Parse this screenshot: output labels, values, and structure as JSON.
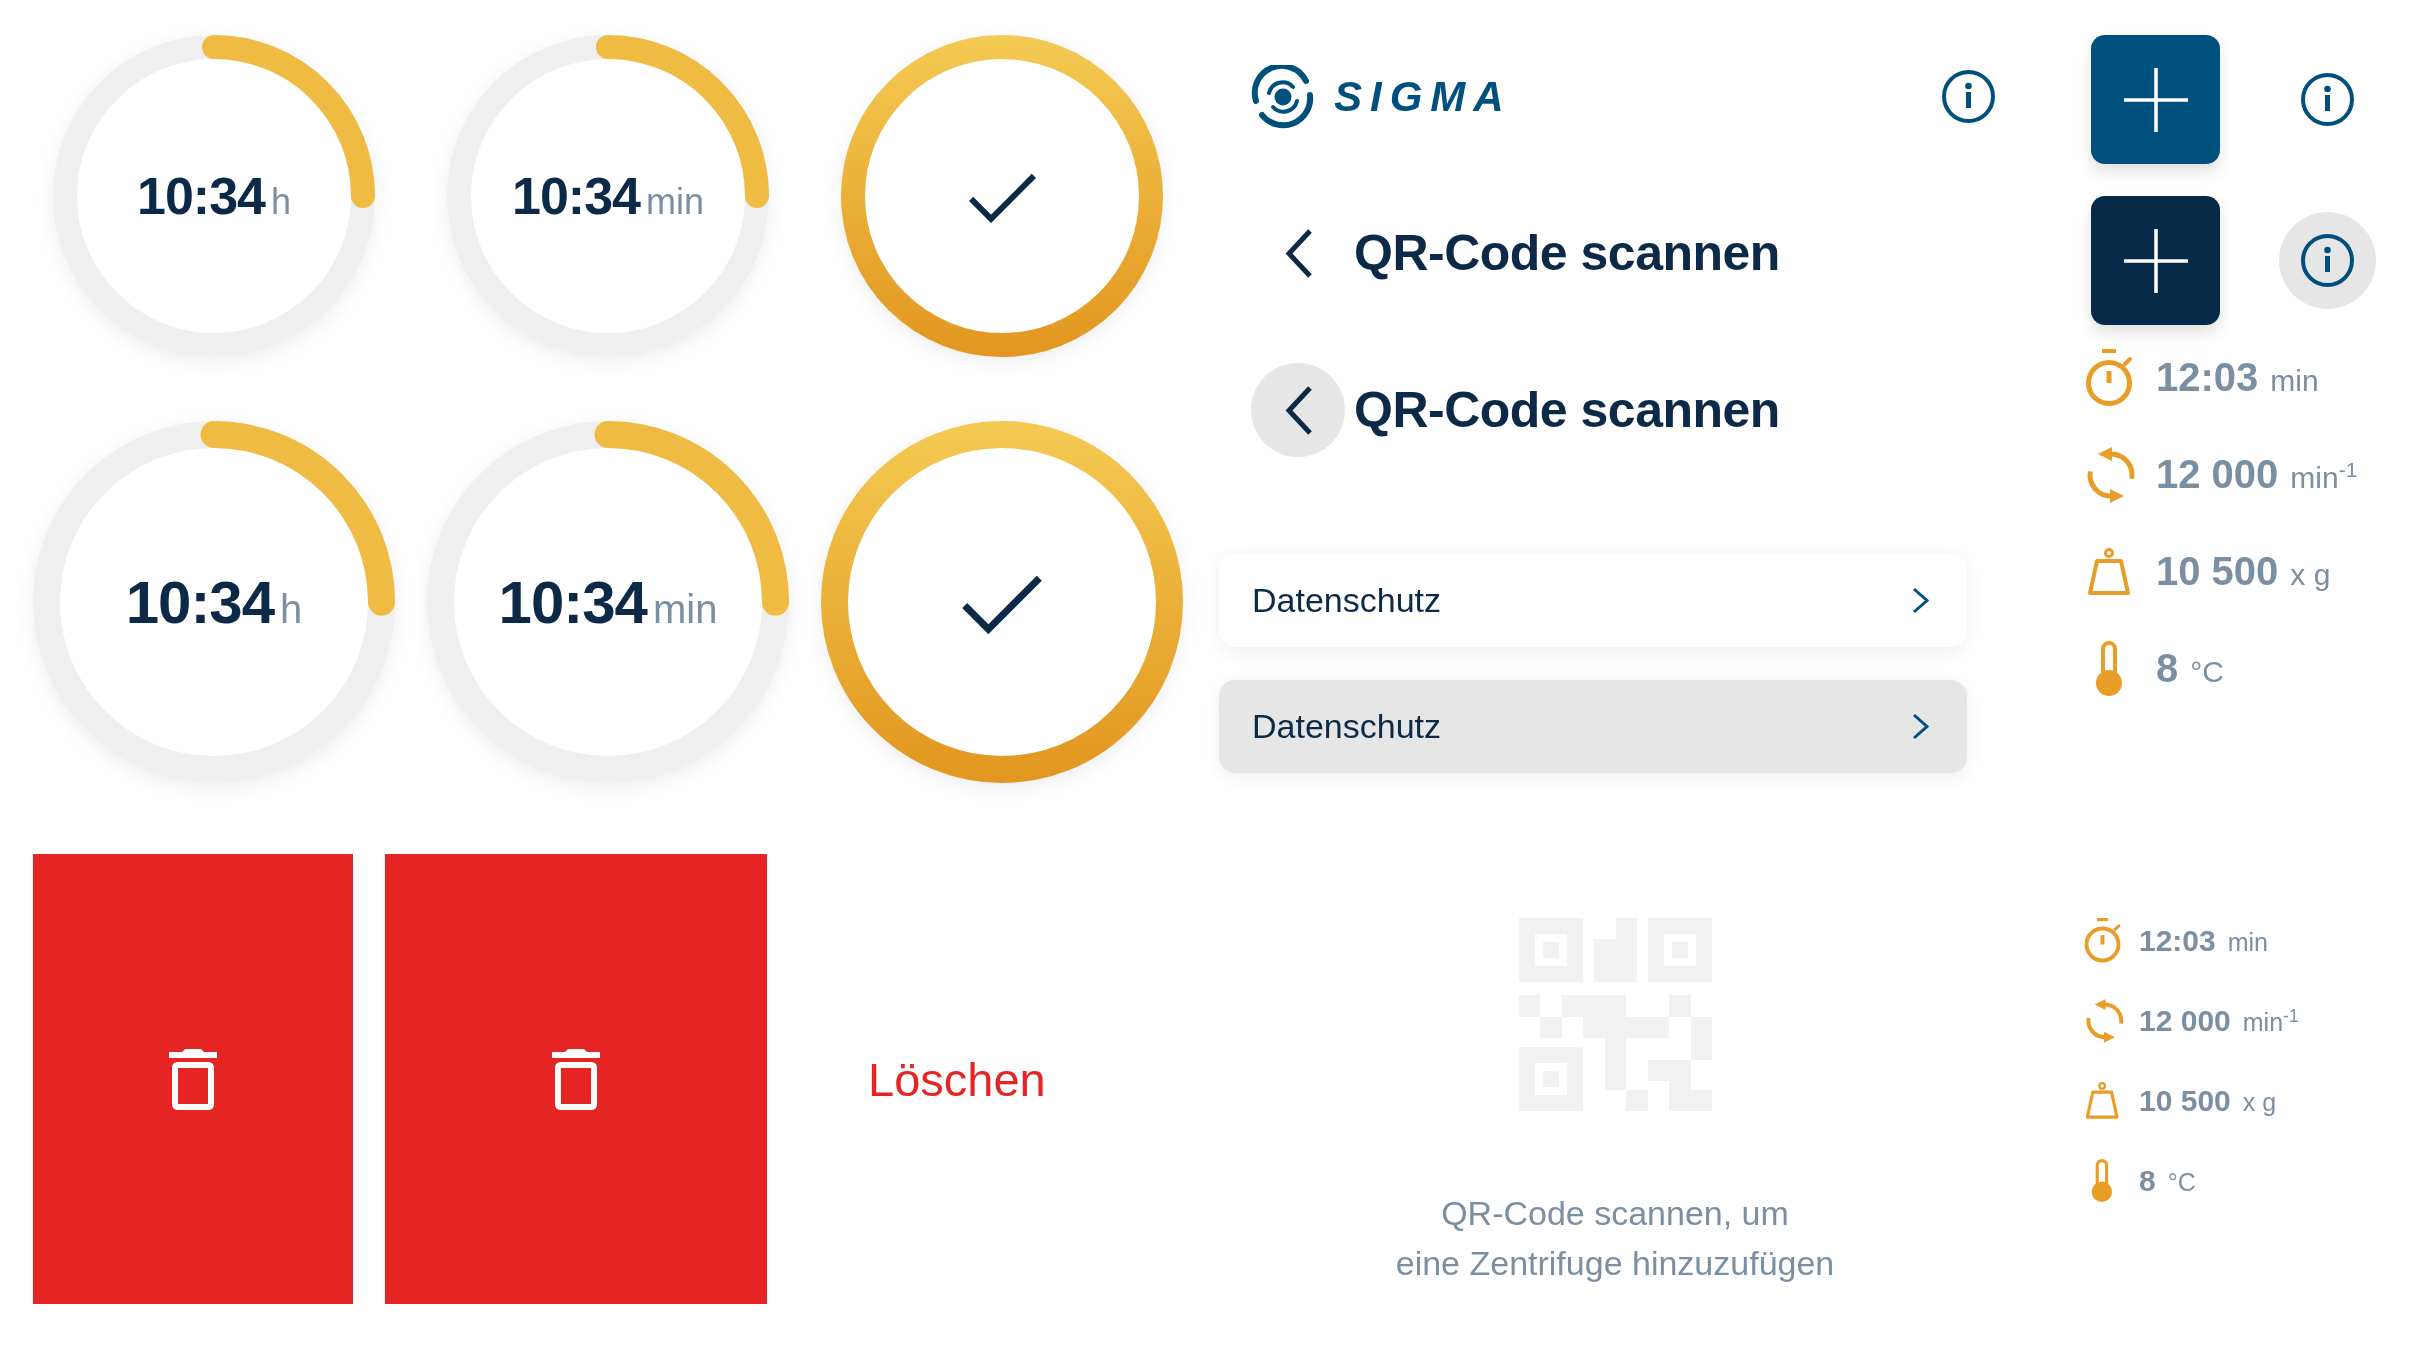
{
  "ring_rows": [
    {
      "rings": [
        {
          "kind": "progress",
          "value": "10:34",
          "unit": "h",
          "level": 0.25
        },
        {
          "kind": "progress",
          "value": "10:34",
          "unit": "min",
          "level": 0.25
        },
        {
          "kind": "done",
          "level": 1
        }
      ]
    },
    {
      "rings": [
        {
          "kind": "progress",
          "value": "10:34",
          "unit": "h",
          "level": 0.25
        },
        {
          "kind": "progress",
          "value": "10:34",
          "unit": "min",
          "level": 0.25
        },
        {
          "kind": "done",
          "level": 1
        }
      ]
    }
  ],
  "delete_actions": [
    {
      "kind": "tile"
    },
    {
      "kind": "tile"
    },
    {
      "kind": "text",
      "label": "Löschen"
    }
  ],
  "header": {
    "logo": "SIGMA",
    "info_button": {
      "pressed": false
    }
  },
  "back_headings": [
    {
      "title": "QR-Code scannen",
      "pressed": false
    },
    {
      "title": "QR-Code scannen",
      "pressed": true
    }
  ],
  "list_items": [
    {
      "label": "Datenschutz",
      "pressed": false
    },
    {
      "label": "Datenschutz",
      "pressed": true
    }
  ],
  "qr_prompt": {
    "caption": "QR-Code scannen, um\neine Zentrifuge hinzuzufügen"
  },
  "action_rows": [
    {
      "add_pressed": false,
      "info_pressed": false
    },
    {
      "add_pressed": true,
      "info_pressed": true
    }
  ],
  "stat_groups": [
    {
      "items": [
        {
          "kind": "time",
          "value": "12:03",
          "unit": "min"
        },
        {
          "kind": "speed",
          "value": "12 000",
          "unit": "min$^{-1}$"
        },
        {
          "kind": "force",
          "value": "10 500",
          "unit": "x g"
        },
        {
          "kind": "temperature",
          "value": "8",
          "unit": "°C"
        }
      ]
    },
    {
      "items": [
        {
          "kind": "time",
          "value": "12:03",
          "unit": "min"
        },
        {
          "kind": "speed",
          "value": "12 000",
          "unit": "min$^{-1}$"
        },
        {
          "kind": "force",
          "value": "10 500",
          "unit": "x g"
        },
        {
          "kind": "temperature",
          "value": "8",
          "unit": "°C"
        }
      ]
    }
  ]
}
